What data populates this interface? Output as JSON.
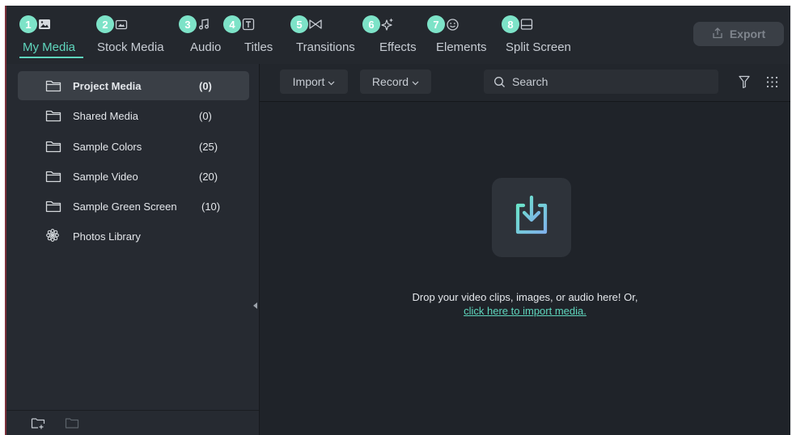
{
  "tabs": [
    {
      "badge": "1",
      "label": "My Media",
      "icon": "image-icon",
      "active": true
    },
    {
      "badge": "2",
      "label": "Stock Media",
      "icon": "stock-media-icon",
      "active": false
    },
    {
      "badge": "3",
      "label": "Audio",
      "icon": "music-note-icon",
      "active": false
    },
    {
      "badge": "4",
      "label": "Titles",
      "icon": "titles-icon",
      "active": false
    },
    {
      "badge": "5",
      "label": "Transitions",
      "icon": "transitions-icon",
      "active": false
    },
    {
      "badge": "6",
      "label": "Effects",
      "icon": "sparkle-icon",
      "active": false
    },
    {
      "badge": "7",
      "label": "Elements",
      "icon": "smiley-icon",
      "active": false
    },
    {
      "badge": "8",
      "label": "Split Screen",
      "icon": "split-screen-icon",
      "active": false
    }
  ],
  "export": {
    "label": "Export",
    "icon": "export-icon"
  },
  "sidebar": {
    "items": [
      {
        "label": "Project Media",
        "count": "(0)",
        "icon": "folder-icon",
        "selected": true
      },
      {
        "label": "Shared Media",
        "count": "(0)",
        "icon": "folder-icon",
        "selected": false
      },
      {
        "label": "Sample Colors",
        "count": "(25)",
        "icon": "folder-icon",
        "selected": false
      },
      {
        "label": "Sample Video",
        "count": "(20)",
        "icon": "folder-icon",
        "selected": false
      },
      {
        "label": "Sample Green Screen",
        "count": "(10)",
        "icon": "folder-icon",
        "selected": false
      },
      {
        "label": "Photos Library",
        "count": "",
        "icon": "photos-flower-icon",
        "selected": false
      }
    ],
    "footer_icons": [
      "new-folder-icon",
      "folder-outline-icon"
    ]
  },
  "toolbar": {
    "import_label": "Import",
    "record_label": "Record",
    "search_placeholder": "Search"
  },
  "dropzone": {
    "text": "Drop your video clips, images, or audio here! Or,",
    "link": "click here to import media."
  },
  "colors": {
    "accent": "#5fd6bd",
    "badge": "#7de3c8",
    "background": "#1f2329",
    "sidebar": "#262a31"
  }
}
